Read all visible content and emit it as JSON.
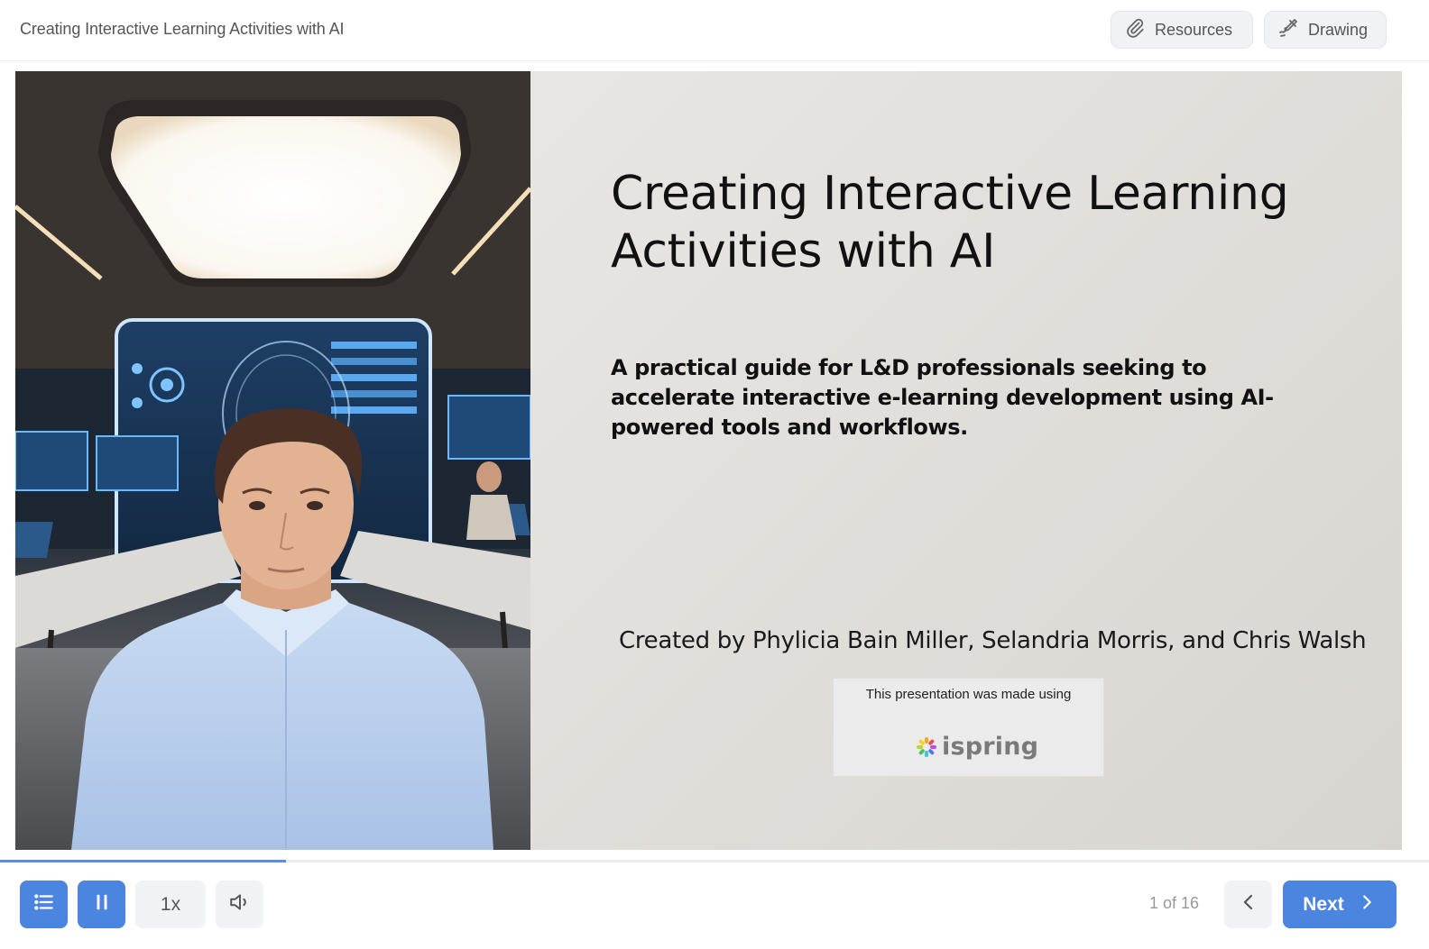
{
  "header": {
    "title": "Creating Interactive Learning Activities with AI",
    "resources_label": "Resources",
    "resources_icon": "paperclip-icon",
    "drawing_label": "Drawing",
    "drawing_icon": "pen-scribble-icon"
  },
  "slide": {
    "title_line1": "Creating Interactive Learning",
    "title_line2": "Activities with AI",
    "subtitle": "A practical guide for L&D professionals seeking to accelerate interactive e-learning development using AI-powered tools and workflows.",
    "credits": "Created by Phylicia Bain Miller, Selandria Morris, and Chris Walsh",
    "watermark_text": "This presentation was made using",
    "watermark_brand": "ispring"
  },
  "progress": {
    "fraction": 0.2
  },
  "controls": {
    "outline_icon": "list-icon",
    "pause_icon": "pause-icon",
    "speed_label": "1x",
    "volume_icon": "volume-icon",
    "counter": "1 of 16",
    "prev_icon": "chevron-left-icon",
    "next_label": "Next",
    "next_icon": "chevron-right-icon"
  },
  "colors": {
    "accent": "#4b85df",
    "progress": "#5b8ee3",
    "button_grey": "#f1f2f4"
  }
}
